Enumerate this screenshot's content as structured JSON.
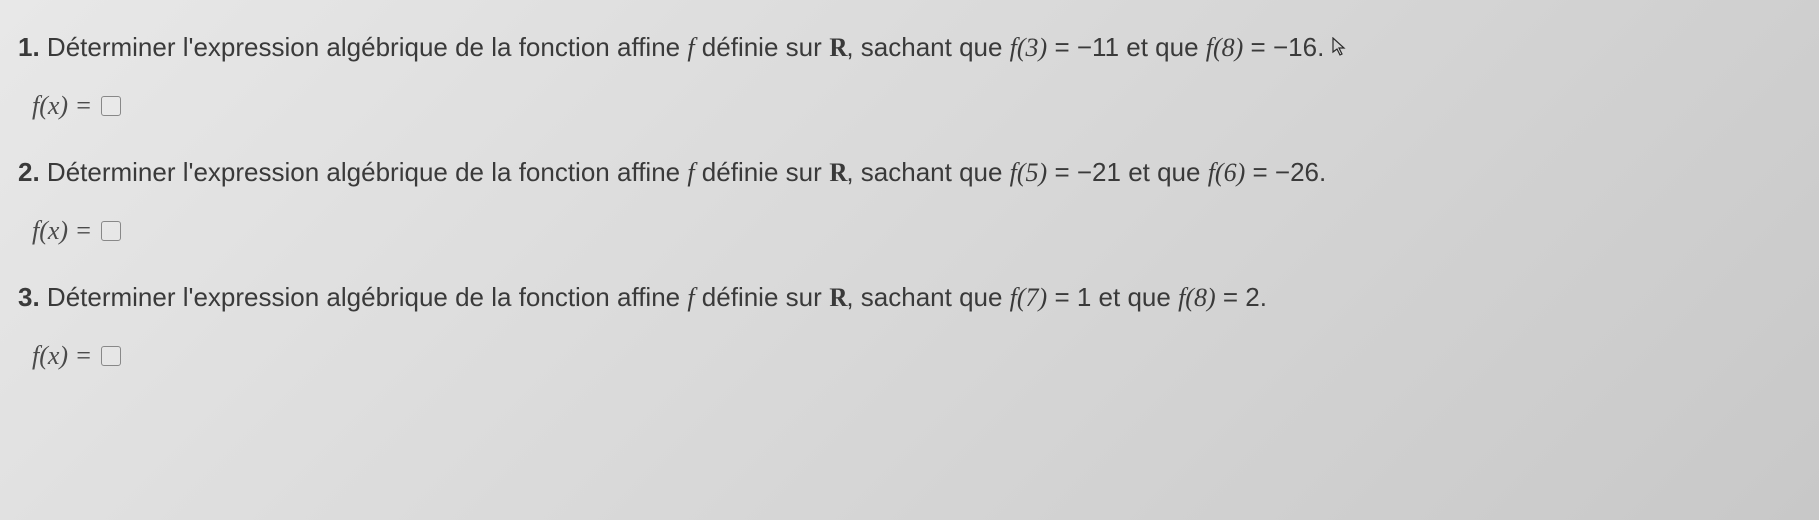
{
  "problems": [
    {
      "number": "1.",
      "prefix": "Déterminer l'expression algébrique de la fonction affine ",
      "func": "f",
      "mid1": " définie sur ",
      "set": "R",
      "mid2": ", sachant que ",
      "cond1_lhs": "f(3)",
      "eq": " = ",
      "cond1_rhs": "−11",
      "conj": " et que ",
      "cond2_lhs": "f(8)",
      "cond2_rhs": "−16",
      "period": ".",
      "answer_lhs": "f(x)",
      "answer_eq": " ="
    },
    {
      "number": "2.",
      "prefix": "Déterminer l'expression algébrique de la fonction affine ",
      "func": "f",
      "mid1": " définie sur ",
      "set": "R",
      "mid2": ", sachant que ",
      "cond1_lhs": "f(5)",
      "eq": " = ",
      "cond1_rhs": "−21",
      "conj": " et que ",
      "cond2_lhs": "f(6)",
      "cond2_rhs": "−26",
      "period": ".",
      "answer_lhs": "f(x)",
      "answer_eq": " ="
    },
    {
      "number": "3.",
      "prefix": "Déterminer l'expression algébrique de la fonction affine ",
      "func": "f",
      "mid1": " définie sur ",
      "set": "R",
      "mid2": ", sachant que ",
      "cond1_lhs": "f(7)",
      "eq": " = ",
      "cond1_rhs": "1",
      "conj": " et que ",
      "cond2_lhs": "f(8)",
      "cond2_rhs": "2",
      "period": ".",
      "answer_lhs": "f(x)",
      "answer_eq": " ="
    }
  ]
}
